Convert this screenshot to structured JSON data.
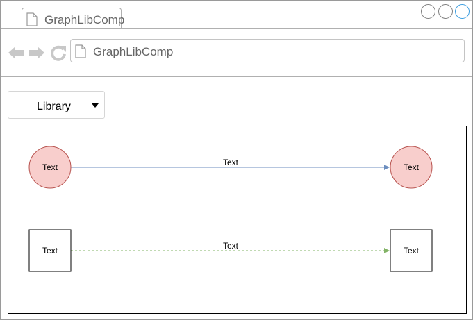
{
  "browser": {
    "tab_title": "GraphLibComp",
    "address": "GraphLibComp",
    "icons": {
      "back": "arrow-left-icon",
      "forward": "arrow-right-icon",
      "reload": "reload-icon",
      "page": "page-icon"
    }
  },
  "toolbar": {
    "library_label": "Library"
  },
  "graph": {
    "row1": {
      "source_label": "Text",
      "target_label": "Text",
      "edge_label": "Text",
      "node_fill": "#f8cecc",
      "node_stroke": "#b85450",
      "edge_color": "#6c8ebf",
      "edge_style": "solid"
    },
    "row2": {
      "source_label": "Text",
      "target_label": "Text",
      "edge_label": "Text",
      "node_fill": "#ffffff",
      "node_stroke": "#000000",
      "edge_color": "#82b366",
      "edge_style": "dashed"
    }
  }
}
